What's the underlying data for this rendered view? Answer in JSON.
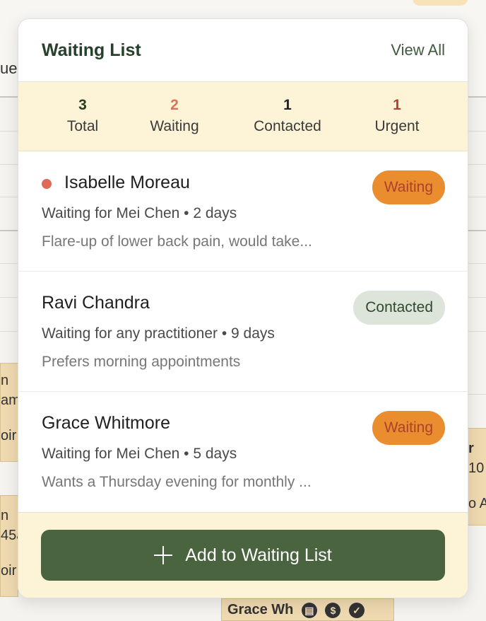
{
  "background": {
    "partial_text_top": "ue",
    "left_appt_1": [
      "n",
      "am",
      "oir"
    ],
    "left_appt_2": [
      "n",
      "45a",
      "oir"
    ],
    "right_appt": [
      "r",
      "10",
      "o A"
    ],
    "bottom_appt": "Grace Wh"
  },
  "panel": {
    "title": "Waiting List",
    "view_all": "View All",
    "stats": [
      {
        "value": "3",
        "label": "Total",
        "color": "#2c3a22"
      },
      {
        "value": "2",
        "label": "Waiting",
        "color": "#d9725a"
      },
      {
        "value": "1",
        "label": "Contacted",
        "color": "#222222"
      },
      {
        "value": "1",
        "label": "Urgent",
        "color": "#b8402e"
      }
    ],
    "entries": [
      {
        "name": "Isabelle Moreau",
        "urgent": true,
        "meta": "Waiting for Mei Chen • 2 days",
        "note": "Flare-up of lower back pain, would take...",
        "status": "Waiting"
      },
      {
        "name": "Ravi Chandra",
        "urgent": false,
        "meta": "Waiting for any practitioner • 9 days",
        "note": "Prefers morning appointments",
        "status": "Contacted"
      },
      {
        "name": "Grace Whitmore",
        "urgent": false,
        "meta": "Waiting for Mei Chen • 5 days",
        "note": "Wants a Thursday evening for monthly ...",
        "status": "Waiting"
      }
    ],
    "add_button": "Add to Waiting List"
  }
}
